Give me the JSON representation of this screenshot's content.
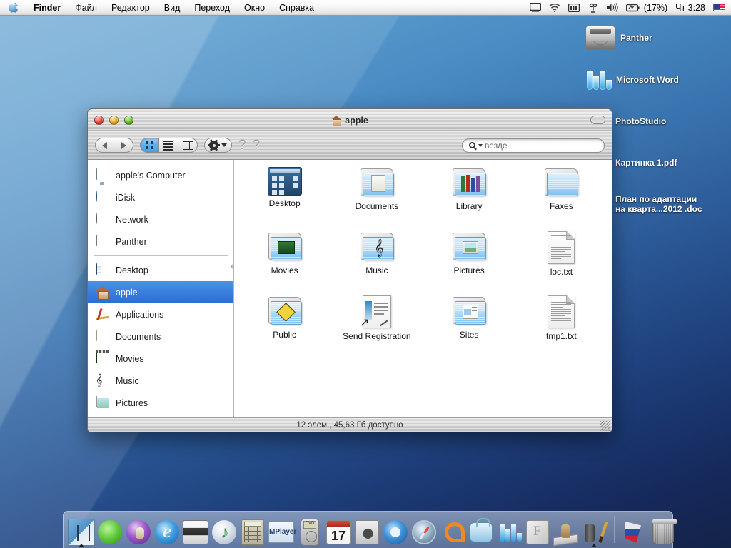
{
  "menubar": {
    "apple_icon": "apple-logo-icon",
    "app_name": "Finder",
    "menus": [
      "Файл",
      "Редактор",
      "Вид",
      "Переход",
      "Окно",
      "Справка"
    ],
    "status_icons": [
      "display-icon",
      "wifi-icon",
      "battery-meter-icon",
      "bluetooth-icon",
      "volume-icon",
      "battery-icon"
    ],
    "battery_percent": "(17%)",
    "clock": "Чт 3:28",
    "input_flag": "us-flag-icon"
  },
  "desktop": {
    "items": [
      {
        "label": "Panther",
        "icon": "hard-drive-icon"
      },
      {
        "label": "Microsoft Word",
        "icon": "microsoft-word-icon"
      },
      {
        "label": "PhotoStudio",
        "icon": "photostudio-icon"
      },
      {
        "label": "Картинка 1.pdf",
        "icon": "pdf-document-icon"
      },
      {
        "label": "План по адаптации\nна кварта...2012 .doc",
        "icon": "word-document-icon"
      }
    ]
  },
  "window": {
    "title": "apple",
    "title_icon": "home-icon",
    "traffic_lights": [
      "close-button",
      "minimize-button",
      "zoom-button"
    ],
    "toolbar": {
      "back_label": "◀",
      "forward_label": "▶",
      "view_icon_label": "icon-view",
      "view_list_label": "list-view",
      "view_column_label": "column-view",
      "action_label": "action-gear",
      "placeholder_1": "?",
      "placeholder_2": "?",
      "search_value": "везде"
    },
    "sidebar": {
      "group_1": [
        {
          "label": "apple's Computer",
          "icon": "computer-icon"
        },
        {
          "label": "iDisk",
          "icon": "idisk-icon"
        },
        {
          "label": "Network",
          "icon": "network-icon"
        },
        {
          "label": "Panther",
          "icon": "hard-drive-icon"
        }
      ],
      "group_2": [
        {
          "label": "Desktop",
          "icon": "desktop-folder-icon",
          "selected": false
        },
        {
          "label": "apple",
          "icon": "home-folder-icon",
          "selected": true
        },
        {
          "label": "Applications",
          "icon": "applications-folder-icon",
          "selected": false
        },
        {
          "label": "Documents",
          "icon": "documents-folder-icon",
          "selected": false
        },
        {
          "label": "Movies",
          "icon": "movies-folder-icon",
          "selected": false
        },
        {
          "label": "Music",
          "icon": "music-folder-icon",
          "selected": false
        },
        {
          "label": "Pictures",
          "icon": "pictures-folder-icon",
          "selected": false
        }
      ]
    },
    "files": [
      {
        "label": "Desktop",
        "icon": "desktop-folder-icon"
      },
      {
        "label": "Documents",
        "icon": "documents-folder-icon"
      },
      {
        "label": "Library",
        "icon": "library-folder-icon"
      },
      {
        "label": "Faxes",
        "icon": "plain-folder-icon"
      },
      {
        "label": "Movies",
        "icon": "movies-folder-icon"
      },
      {
        "label": "Music",
        "icon": "music-folder-icon"
      },
      {
        "label": "Pictures",
        "icon": "pictures-folder-icon"
      },
      {
        "label": "loc.txt",
        "icon": "text-document-icon"
      },
      {
        "label": "Public",
        "icon": "public-folder-icon"
      },
      {
        "label": "Send Registration",
        "icon": "registration-alias-icon"
      },
      {
        "label": "Sites",
        "icon": "sites-folder-icon"
      },
      {
        "label": "tmp1.txt",
        "icon": "text-document-icon"
      }
    ],
    "status": "12 элем., 45,63 Гб доступно"
  },
  "dock": {
    "items": [
      {
        "name": "finder",
        "running": true
      },
      {
        "name": "xchat",
        "running": false
      },
      {
        "name": "quicktime-purple",
        "running": false
      },
      {
        "name": "internet-explorer",
        "running": false
      },
      {
        "name": "print-center",
        "running": false
      },
      {
        "name": "itunes",
        "running": false
      },
      {
        "name": "calculator",
        "running": false
      },
      {
        "name": "mplayer",
        "running": false
      },
      {
        "name": "dvd-player",
        "running": false
      },
      {
        "name": "ical",
        "running": false,
        "day": "17"
      },
      {
        "name": "system-preferences",
        "running": false
      },
      {
        "name": "quicktime",
        "running": false
      },
      {
        "name": "safari",
        "running": false
      },
      {
        "name": "preview-orange",
        "running": false
      },
      {
        "name": "sherlock-bag",
        "running": false
      },
      {
        "name": "microsoft-word",
        "running": false
      },
      {
        "name": "font-book",
        "running": false
      },
      {
        "name": "chess",
        "running": false
      },
      {
        "name": "photostudio",
        "running": true
      }
    ],
    "trash_group": [
      {
        "name": "russian-flag-app",
        "running": false
      },
      {
        "name": "trash",
        "running": false
      }
    ]
  },
  "colors": {
    "selection_blue": "#2a6fd4",
    "menubar_bg": "#ededed",
    "desktop_top": "#6aa7d4",
    "desktop_bottom": "#132348"
  }
}
